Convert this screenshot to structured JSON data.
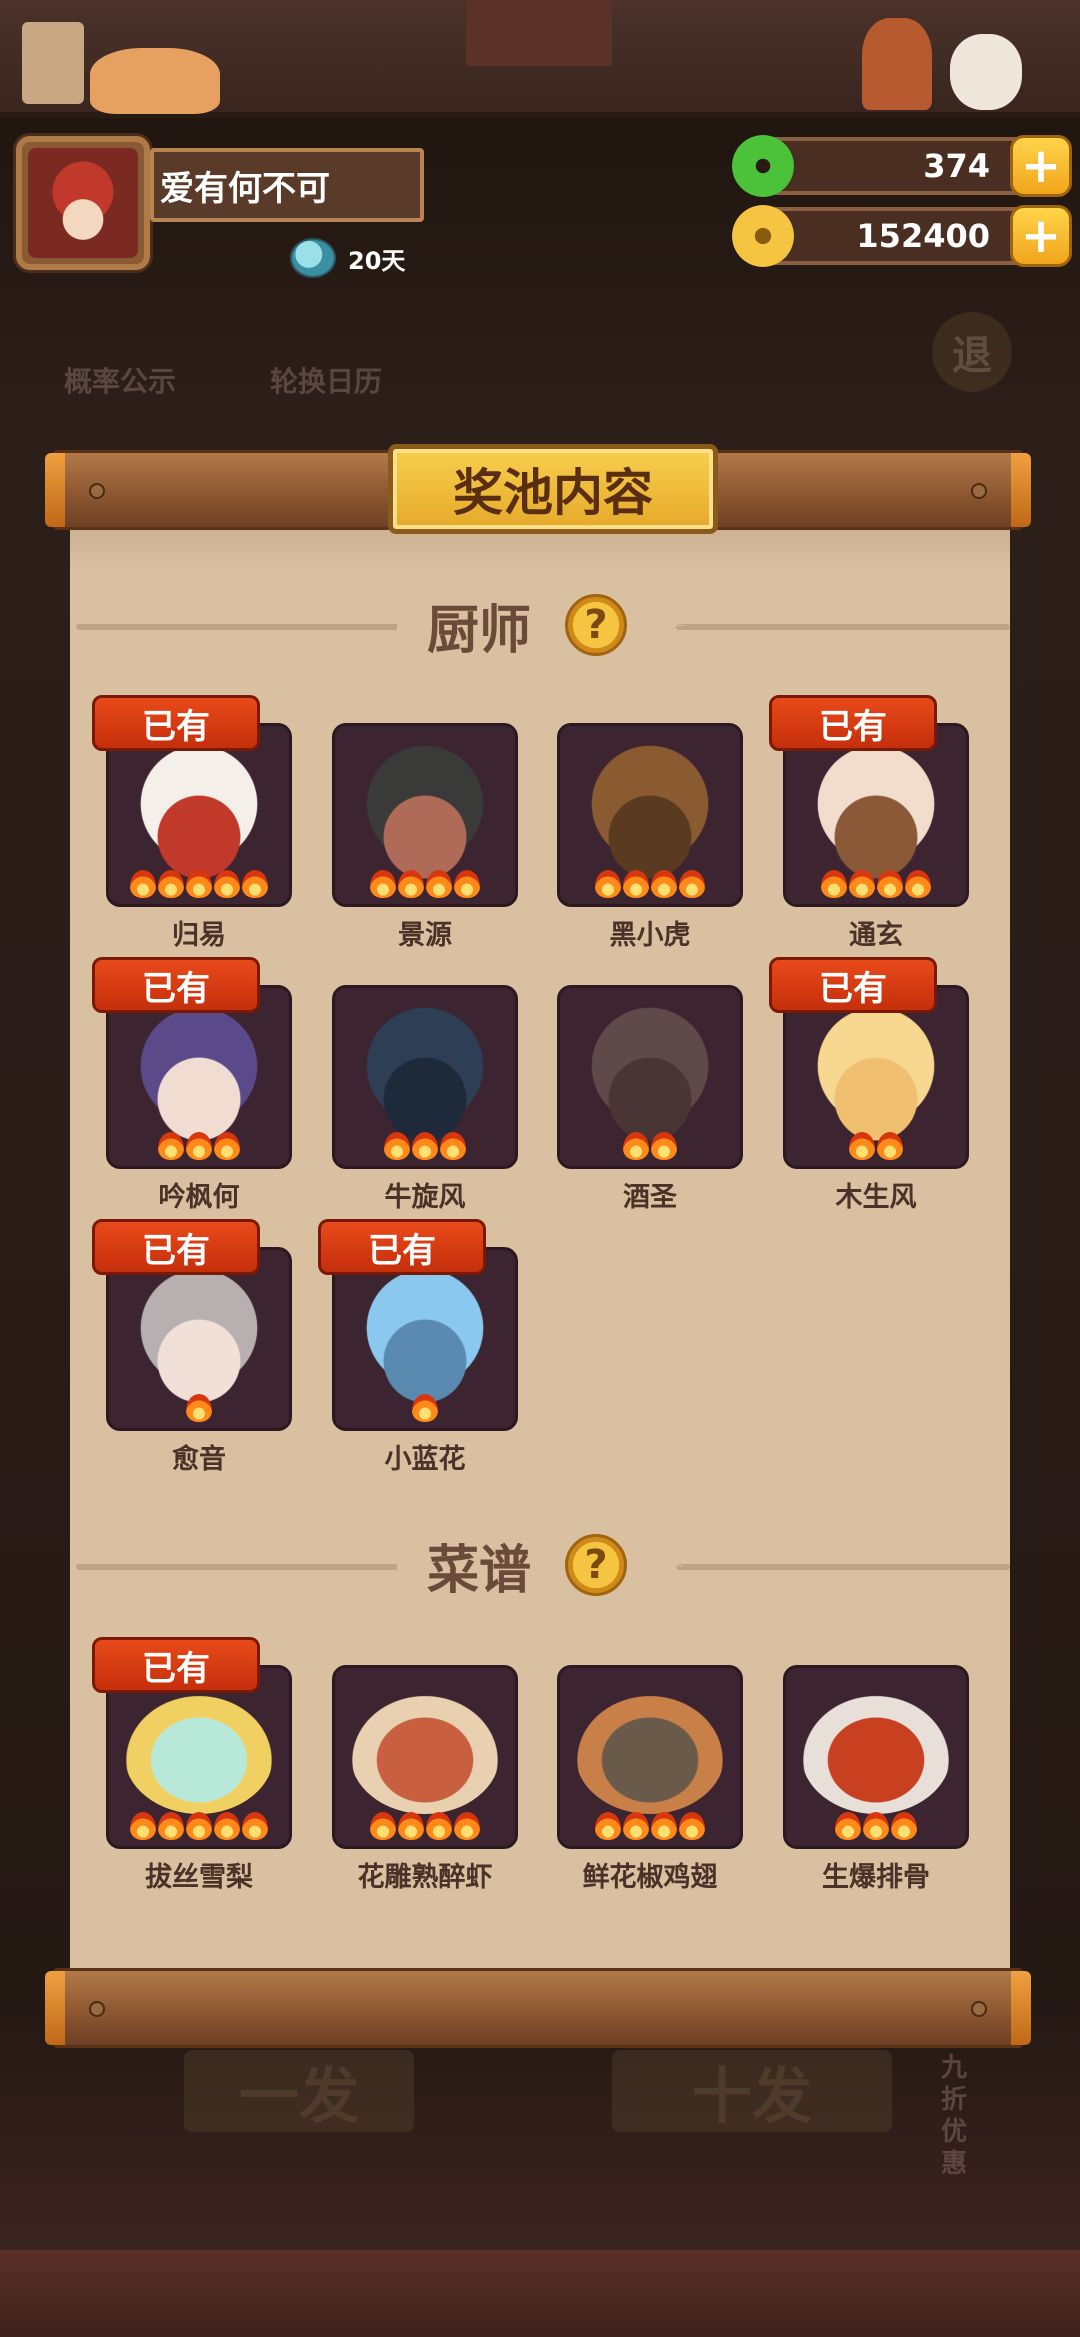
{
  "user": {
    "name": "爱有何不可",
    "days": "20天"
  },
  "currency": {
    "jade": "374",
    "coins": "152400"
  },
  "background_buttons": {
    "probability": "概率公示",
    "calendar": "轮换日历",
    "back": "退",
    "single_pull": "一发",
    "ten_pull": "十发",
    "discount": "九折优惠"
  },
  "panel": {
    "title": "奖池内容",
    "chefs_title": "厨师",
    "recipes_title": "菜谱",
    "owned_label": "已有",
    "chefs": [
      {
        "name": "归易",
        "stars": 5,
        "owned": true
      },
      {
        "name": "景源",
        "stars": 4,
        "owned": false
      },
      {
        "name": "黑小虎",
        "stars": 4,
        "owned": false
      },
      {
        "name": "通玄",
        "stars": 4,
        "owned": true
      },
      {
        "name": "吟枫何",
        "stars": 3,
        "owned": true
      },
      {
        "name": "牛旋风",
        "stars": 3,
        "owned": false
      },
      {
        "name": "酒圣",
        "stars": 2,
        "owned": false
      },
      {
        "name": "木生风",
        "stars": 2,
        "owned": true
      },
      {
        "name": "愈音",
        "stars": 1,
        "owned": true
      },
      {
        "name": "小蓝花",
        "stars": 1,
        "owned": true
      }
    ],
    "recipes": [
      {
        "name": "拔丝雪梨",
        "stars": 5,
        "owned": true
      },
      {
        "name": "花雕熟醉虾",
        "stars": 4,
        "owned": false
      },
      {
        "name": "鲜花椒鸡翅",
        "stars": 4,
        "owned": false
      },
      {
        "name": "生爆排骨",
        "stars": 3,
        "owned": false
      }
    ]
  },
  "colors": {
    "panel": "#d8c0a0",
    "owned_badge": "#d63a12",
    "card": "#3c2430"
  }
}
